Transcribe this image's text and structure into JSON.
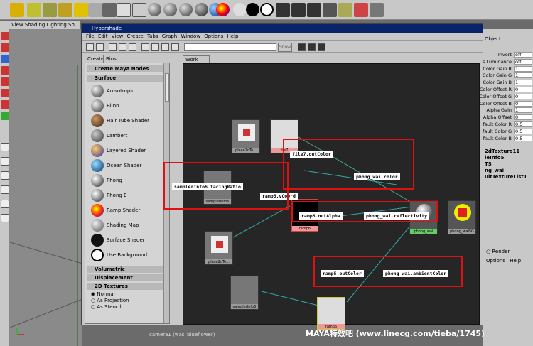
{
  "main_menu": "View Shading Lighting Sh",
  "hypershade": {
    "title": "Hypershade",
    "menu": "File Edit View Create Tabs Graph Window Options Help",
    "show_button": "Show",
    "tabs": [
      "Create",
      "Bins"
    ],
    "create_header": "Create Maya Nodes",
    "sections": {
      "surface": "Surface",
      "volumetric": "Volumetric",
      "displacement": "Displacement",
      "textures2d": "2D Textures"
    },
    "surface_nodes": [
      "Anisotropic",
      "Blinn",
      "Hair Tube Shader",
      "Lambert",
      "Layered Shader",
      "Ocean Shader",
      "Phong",
      "Phong E",
      "Ramp Shader",
      "Shading Map",
      "Surface Shader",
      "Use Background"
    ],
    "texture_modes": [
      "Normal",
      "As Projection",
      "As Stencil"
    ],
    "work_area_tab": "Work Area"
  },
  "graph": {
    "labels": {
      "file7_outcolor": "file7.outColor",
      "phong_color": "phong_wai.color",
      "sampler_facing": "samplerInfo6.facingRatio",
      "ramp6_vcoord": "ramp6.vCoord",
      "ramp6_outalpha": "ramp6.outAlpha",
      "phong_reflectivity": "phong_wai.reflectivity",
      "ramp5_outcolor": "ramp5.outColor",
      "phong_ambient": "phong_wai.ambientColor"
    },
    "swatches": {
      "place2d_a": "place2dTe...",
      "file7": "file7",
      "sampler_a": "samplerInfo6",
      "ramp6": "ramp6",
      "place2d_b": "place2dTe...",
      "phong": "phong_wai",
      "phong_sg": "phong_waiSG",
      "sampler_b": "samplerInfo5",
      "ramp5": "ramp5"
    }
  },
  "attribute_editor": {
    "header": "Object",
    "rows": [
      {
        "name": "Invert",
        "value": "off"
      },
      {
        "name": "s Luminance",
        "value": "off"
      },
      {
        "name": "Color Gain R",
        "value": "1"
      },
      {
        "name": "Color Gain G",
        "value": "1"
      },
      {
        "name": "Color Gain B",
        "value": "1"
      },
      {
        "name": "Color Offset R",
        "value": "0"
      },
      {
        "name": "Color Offset G",
        "value": "0"
      },
      {
        "name": "Color Offset B",
        "value": "0"
      },
      {
        "name": "Alpha Gain",
        "value": "1"
      },
      {
        "name": "Alpha Offset",
        "value": "0"
      },
      {
        "name": "fault Color R",
        "value": "0.5"
      },
      {
        "name": "fault Color G",
        "value": "0.5"
      },
      {
        "name": "fault Color B",
        "value": "0.5"
      }
    ],
    "connections": [
      "2dTexture11",
      "leInfo5",
      "TS",
      "ng_wai",
      "ultTextureList1"
    ],
    "render_label": "Render",
    "bottom_menu": "Options Help"
  },
  "status_text": "camera1 (was_blueflower)",
  "watermark": "MAYA特效吧 (www.linecg.com/tieba/1745)",
  "colors": {
    "highlight": "#e01010",
    "title_bar": "#0a246a",
    "work_area": "#262626"
  }
}
